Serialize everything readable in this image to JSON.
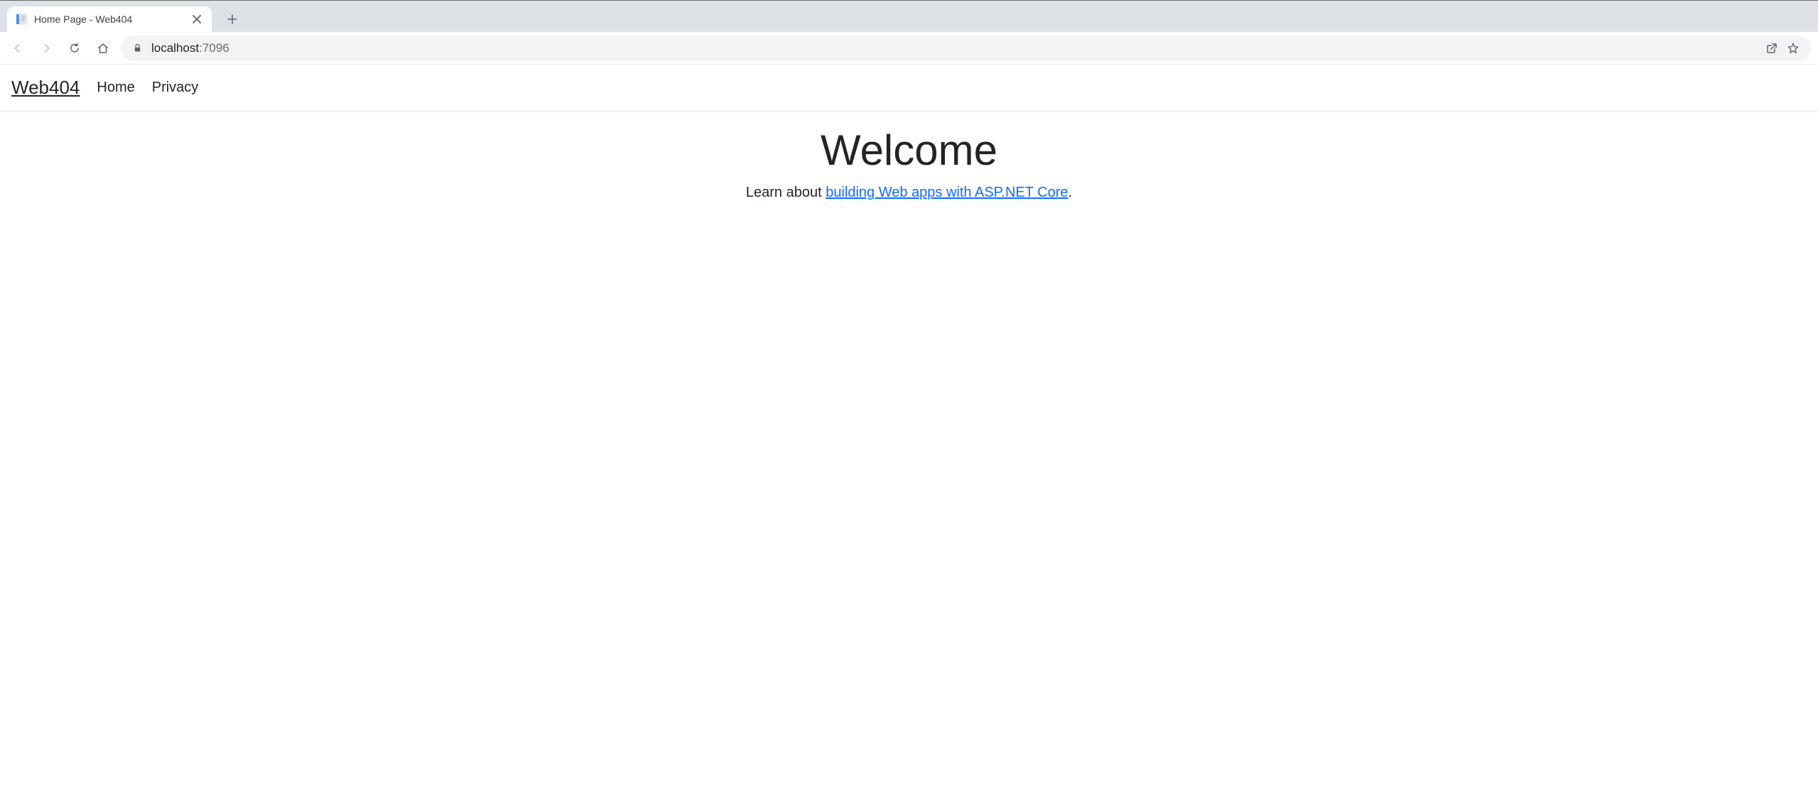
{
  "browser": {
    "tab_title": "Home Page - Web404",
    "url_host": "localhost",
    "url_port": ":7096"
  },
  "nav": {
    "brand": "Web404",
    "links": [
      "Home",
      "Privacy"
    ]
  },
  "hero": {
    "heading": "Welcome",
    "lead_prefix": "Learn about ",
    "lead_link": "building Web apps with ASP.NET Core",
    "lead_suffix": "."
  }
}
